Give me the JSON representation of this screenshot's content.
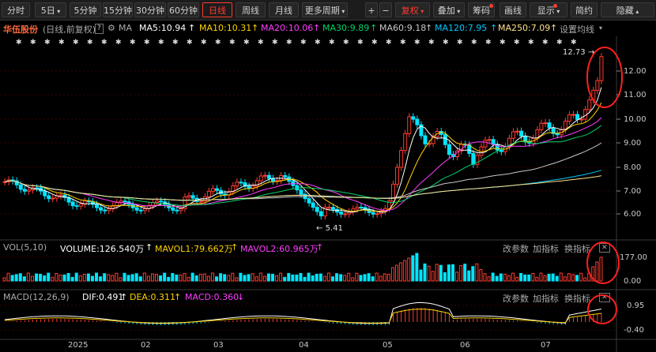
{
  "toolbar": {
    "periods": [
      "分时",
      "5日",
      "5分钟",
      "15分钟",
      "30分钟",
      "60分钟",
      "日线",
      "周线",
      "月线",
      "更多周期"
    ],
    "active_period": "日线",
    "plus": "+",
    "minus": "−",
    "restore_rights": "复权",
    "overlay": "叠加",
    "chips": "筹码",
    "draw": "画线",
    "display": "显示",
    "brief": "简约",
    "hide": "隐藏"
  },
  "main_info": {
    "stock_name": "华伍股份",
    "mode": "(日线,前复权)",
    "help": "?",
    "ma_label": "MA",
    "ma5": "MA5:10.94",
    "ma10": "MA10:10.31",
    "ma20": "MA20:10.06",
    "ma30": "MA30:9.89",
    "ma60": "MA60:9.18",
    "ma120": "MA120:7.95",
    "ma250": "MA250:7.09",
    "settings": "设置均线",
    "high_mark": "12.73",
    "low_mark": "5.41",
    "price_ticks": [
      "12.00",
      "11.00",
      "10.00",
      "9.00",
      "8.00",
      "7.00",
      "6.00"
    ],
    "colors": {
      "ma5": "#ffffff",
      "ma10": "#ffd200",
      "ma20": "#ff3cff",
      "ma30": "#00d26a",
      "ma60": "#c8c8c8",
      "ma120": "#00c8ff",
      "ma250": "#ffe08a",
      "up": "#ff3b30",
      "down": "#00e5ff"
    }
  },
  "vol_panel": {
    "label": "VOL(5,10)",
    "volume": "VOLUME:126.540万",
    "mavol1": "MAVOL1:79.662万",
    "mavol2": "MAVOL2:60.965万",
    "btn_params": "改参数",
    "btn_add": "加指标",
    "btn_switch": "换指标",
    "ticks": [
      "177.00",
      "0.00"
    ]
  },
  "macd_panel": {
    "label": "MACD(12,26,9)",
    "dif": "DIF:0.491",
    "dea": "DEA:0.311",
    "macd": "MACD:0.360",
    "btn_params": "改参数",
    "btn_add": "加指标",
    "btn_switch": "换指标",
    "ticks": [
      "0.95",
      "-0.40"
    ]
  },
  "x_axis": [
    "2025",
    "02",
    "03",
    "04",
    "05",
    "06",
    "07"
  ]
}
